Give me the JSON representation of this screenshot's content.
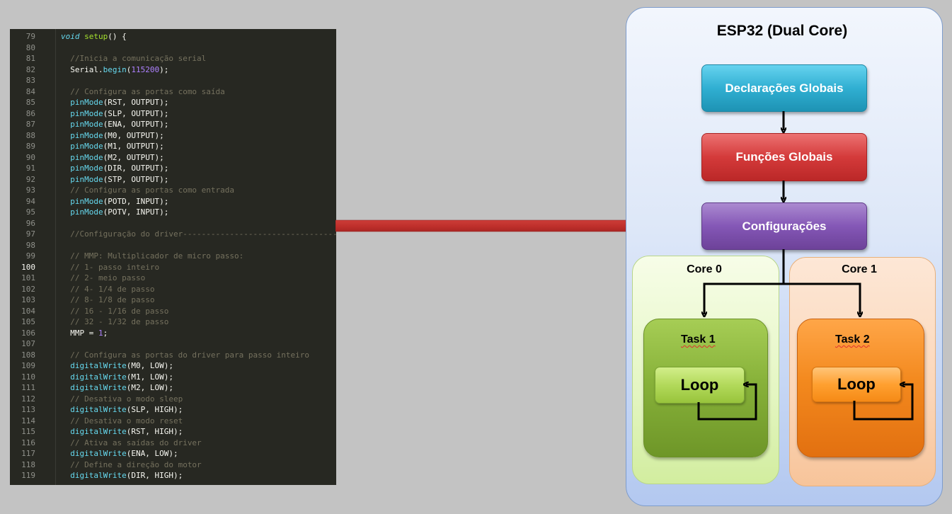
{
  "editor": {
    "lines": [
      {
        "n": "79",
        "parts": [
          [
            "kw",
            "void"
          ],
          [
            "t",
            " "
          ],
          [
            "sf",
            "setup"
          ],
          [
            "t",
            "() {"
          ]
        ]
      },
      {
        "n": "80",
        "parts": []
      },
      {
        "n": "81",
        "parts": [
          [
            "t",
            "  "
          ],
          [
            "cm",
            "//Inicia a comunicação serial"
          ]
        ]
      },
      {
        "n": "82",
        "parts": [
          [
            "t",
            "  Serial."
          ],
          [
            "fn",
            "begin"
          ],
          [
            "t",
            "("
          ],
          [
            "num",
            "115200"
          ],
          [
            "t",
            ");"
          ]
        ]
      },
      {
        "n": "83",
        "parts": []
      },
      {
        "n": "84",
        "parts": [
          [
            "t",
            "  "
          ],
          [
            "cm",
            "// Configura as portas como saída"
          ]
        ]
      },
      {
        "n": "85",
        "parts": [
          [
            "t",
            "  "
          ],
          [
            "fn",
            "pinMode"
          ],
          [
            "t",
            "(RST, OUTPUT);"
          ]
        ]
      },
      {
        "n": "86",
        "parts": [
          [
            "t",
            "  "
          ],
          [
            "fn",
            "pinMode"
          ],
          [
            "t",
            "(SLP, OUTPUT);"
          ]
        ]
      },
      {
        "n": "87",
        "parts": [
          [
            "t",
            "  "
          ],
          [
            "fn",
            "pinMode"
          ],
          [
            "t",
            "(ENA, OUTPUT);"
          ]
        ]
      },
      {
        "n": "88",
        "parts": [
          [
            "t",
            "  "
          ],
          [
            "fn",
            "pinMode"
          ],
          [
            "t",
            "(M0, OUTPUT);"
          ]
        ]
      },
      {
        "n": "89",
        "parts": [
          [
            "t",
            "  "
          ],
          [
            "fn",
            "pinMode"
          ],
          [
            "t",
            "(M1, OUTPUT);"
          ]
        ]
      },
      {
        "n": "90",
        "parts": [
          [
            "t",
            "  "
          ],
          [
            "fn",
            "pinMode"
          ],
          [
            "t",
            "(M2, OUTPUT);"
          ]
        ]
      },
      {
        "n": "91",
        "parts": [
          [
            "t",
            "  "
          ],
          [
            "fn",
            "pinMode"
          ],
          [
            "t",
            "(DIR, OUTPUT);"
          ]
        ]
      },
      {
        "n": "92",
        "parts": [
          [
            "t",
            "  "
          ],
          [
            "fn",
            "pinMode"
          ],
          [
            "t",
            "(STP, OUTPUT);"
          ]
        ]
      },
      {
        "n": "93",
        "parts": [
          [
            "t",
            "  "
          ],
          [
            "cm",
            "// Configura as portas como entrada"
          ]
        ]
      },
      {
        "n": "94",
        "parts": [
          [
            "t",
            "  "
          ],
          [
            "fn",
            "pinMode"
          ],
          [
            "t",
            "(POTD, INPUT);"
          ]
        ]
      },
      {
        "n": "95",
        "parts": [
          [
            "t",
            "  "
          ],
          [
            "fn",
            "pinMode"
          ],
          [
            "t",
            "(POTV, INPUT);"
          ]
        ]
      },
      {
        "n": "96",
        "parts": []
      },
      {
        "n": "97",
        "parts": [
          [
            "t",
            "  "
          ],
          [
            "cm",
            "//Configuração do driver-----------------------------------"
          ]
        ]
      },
      {
        "n": "98",
        "parts": []
      },
      {
        "n": "99",
        "parts": [
          [
            "t",
            "  "
          ],
          [
            "cm",
            "// MMP: Multiplicador de micro passo:"
          ]
        ]
      },
      {
        "n": "100",
        "parts": [
          [
            "t",
            "  "
          ],
          [
            "cm",
            "// 1- passo inteiro"
          ]
        ],
        "current": true
      },
      {
        "n": "101",
        "parts": [
          [
            "t",
            "  "
          ],
          [
            "cm",
            "// 2- meio passo"
          ]
        ]
      },
      {
        "n": "102",
        "parts": [
          [
            "t",
            "  "
          ],
          [
            "cm",
            "// 4- 1/4 de passo"
          ]
        ]
      },
      {
        "n": "103",
        "parts": [
          [
            "t",
            "  "
          ],
          [
            "cm",
            "// 8- 1/8 de passo"
          ]
        ]
      },
      {
        "n": "104",
        "parts": [
          [
            "t",
            "  "
          ],
          [
            "cm",
            "// 16 - 1/16 de passo"
          ]
        ]
      },
      {
        "n": "105",
        "parts": [
          [
            "t",
            "  "
          ],
          [
            "cm",
            "// 32 - 1/32 de passo"
          ]
        ]
      },
      {
        "n": "106",
        "parts": [
          [
            "t",
            "  MMP = "
          ],
          [
            "num",
            "1"
          ],
          [
            "t",
            ";"
          ]
        ]
      },
      {
        "n": "107",
        "parts": []
      },
      {
        "n": "108",
        "parts": [
          [
            "t",
            "  "
          ],
          [
            "cm",
            "// Configura as portas do driver para passo inteiro"
          ]
        ]
      },
      {
        "n": "109",
        "parts": [
          [
            "t",
            "  "
          ],
          [
            "fn",
            "digitalWrite"
          ],
          [
            "t",
            "(M0, LOW);"
          ]
        ]
      },
      {
        "n": "110",
        "parts": [
          [
            "t",
            "  "
          ],
          [
            "fn",
            "digitalWrite"
          ],
          [
            "t",
            "(M1, LOW);"
          ]
        ]
      },
      {
        "n": "111",
        "parts": [
          [
            "t",
            "  "
          ],
          [
            "fn",
            "digitalWrite"
          ],
          [
            "t",
            "(M2, LOW);"
          ]
        ]
      },
      {
        "n": "112",
        "parts": [
          [
            "t",
            "  "
          ],
          [
            "cm",
            "// Desativa o modo sleep"
          ]
        ]
      },
      {
        "n": "113",
        "parts": [
          [
            "t",
            "  "
          ],
          [
            "fn",
            "digitalWrite"
          ],
          [
            "t",
            "(SLP, HIGH);"
          ]
        ]
      },
      {
        "n": "114",
        "parts": [
          [
            "t",
            "  "
          ],
          [
            "cm",
            "// Desativa o modo reset"
          ]
        ]
      },
      {
        "n": "115",
        "parts": [
          [
            "t",
            "  "
          ],
          [
            "fn",
            "digitalWrite"
          ],
          [
            "t",
            "(RST, HIGH);"
          ]
        ]
      },
      {
        "n": "116",
        "parts": [
          [
            "t",
            "  "
          ],
          [
            "cm",
            "// Ativa as saídas do driver"
          ]
        ]
      },
      {
        "n": "117",
        "parts": [
          [
            "t",
            "  "
          ],
          [
            "fn",
            "digitalWrite"
          ],
          [
            "t",
            "(ENA, LOW);"
          ]
        ]
      },
      {
        "n": "118",
        "parts": [
          [
            "t",
            "  "
          ],
          [
            "cm",
            "// Define a direção do motor"
          ]
        ]
      },
      {
        "n": "119",
        "parts": [
          [
            "t",
            "  "
          ],
          [
            "fn",
            "digitalWrite"
          ],
          [
            "t",
            "(DIR, HIGH);"
          ]
        ]
      }
    ]
  },
  "diagram": {
    "title": "ESP32 (Dual Core)",
    "boxes": {
      "declaracoes": "Declarações Globais",
      "funcoes": "Funções Globais",
      "configuracoes": "Configurações"
    },
    "core0": {
      "title": "Core 0",
      "task": "Task 1",
      "loop": "Loop"
    },
    "core1": {
      "title": "Core 1",
      "task": "Task 2",
      "loop": "Loop"
    }
  },
  "colors": {
    "arrow": "#c0302c",
    "connector": "#000000"
  }
}
